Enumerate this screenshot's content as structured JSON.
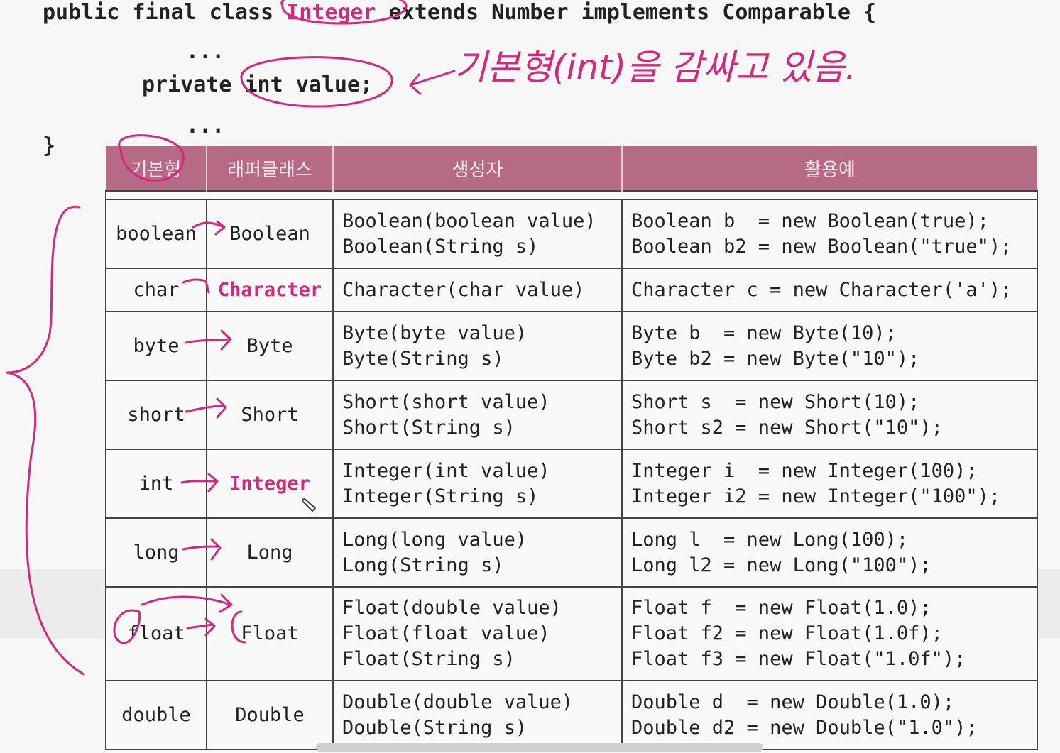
{
  "code": {
    "line1": "public final class Integer extends Number implements Comparable {",
    "line1_a": "public final class ",
    "line1_b": "Integer",
    "line1_c": " extends Number implements Comparable {",
    "dots1": "...",
    "line2": "private int value;",
    "dots2": "...",
    "close": "}"
  },
  "handwriting": "기본형(int)을 감싸고 있음.",
  "table": {
    "headers": [
      "기본형",
      "래퍼클래스",
      "생성자",
      "활용예"
    ],
    "rows": [
      {
        "primitive": "boolean",
        "wrapper": "Boolean",
        "constructors": "Boolean(boolean value)\nBoolean(String s)",
        "examples": "Boolean b  = new Boolean(true);\nBoolean b2 = new Boolean(\"true\");"
      },
      {
        "primitive": "char",
        "wrapper": "Character",
        "constructors": "Character(char value)",
        "examples": "Character c = new Character('a');"
      },
      {
        "primitive": "byte",
        "wrapper": "Byte",
        "constructors": "Byte(byte value)\nByte(String s)",
        "examples": "Byte b  = new Byte(10);\nByte b2 = new Byte(\"10\");"
      },
      {
        "primitive": "short",
        "wrapper": "Short",
        "constructors": "Short(short value)\nShort(String s)",
        "examples": "Short s  = new Short(10);\nShort s2 = new Short(\"10\");"
      },
      {
        "primitive": "int",
        "wrapper": "Integer",
        "constructors": "Integer(int value)\nInteger(String s)",
        "examples": "Integer i  = new Integer(100);\nInteger i2 = new Integer(\"100\");"
      },
      {
        "primitive": "long",
        "wrapper": "Long",
        "constructors": "Long(long value)\nLong(String s)",
        "examples": "Long l  = new Long(100);\nLong l2 = new Long(\"100\");"
      },
      {
        "primitive": "float",
        "wrapper": "Float",
        "constructors": "Float(double value)\nFloat(float value)\nFloat(String s)",
        "examples": "Float f  = new Float(1.0);\nFloat f2 = new Float(1.0f);\nFloat f3 = new Float(\"1.0f\");"
      },
      {
        "primitive": "double",
        "wrapper": "Double",
        "constructors": "Double(double value)\nDouble(String s)",
        "examples": "Double d  = new Double(1.0);\nDouble d2 = new Double(\"1.0\");"
      }
    ]
  },
  "colors": {
    "header_bg": "#b56b86",
    "ink": "#d02a7d"
  }
}
